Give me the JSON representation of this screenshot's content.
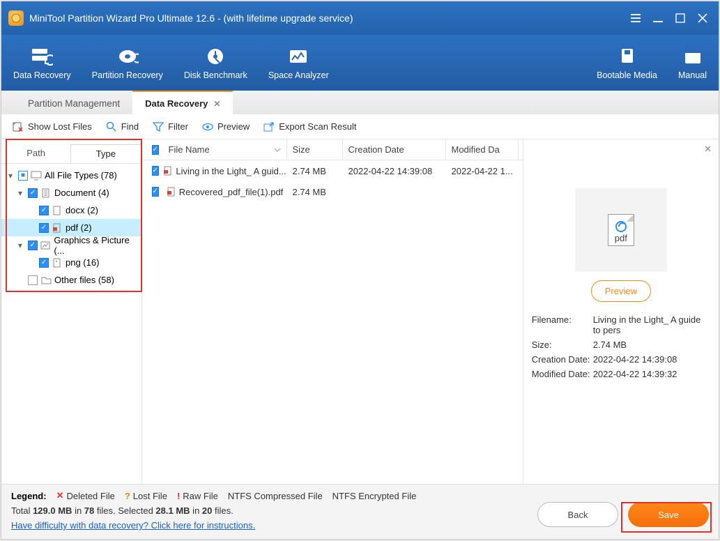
{
  "window": {
    "title": "MiniTool Partition Wizard Pro Ultimate 12.6 - (with lifetime upgrade service)"
  },
  "ribbon": {
    "data_recovery": "Data Recovery",
    "partition_recovery": "Partition Recovery",
    "disk_benchmark": "Disk Benchmark",
    "space_analyzer": "Space Analyzer",
    "bootable_media": "Bootable Media",
    "manual": "Manual"
  },
  "tabs": {
    "partition_mgmt": "Partition Management",
    "data_recovery": "Data Recovery"
  },
  "toolbar": {
    "show_lost": "Show Lost Files",
    "find": "Find",
    "filter": "Filter",
    "preview": "Preview",
    "export": "Export Scan Result"
  },
  "tree_tabs": {
    "path": "Path",
    "type": "Type"
  },
  "tree": {
    "all": "All File Types (78)",
    "doc": "Document (4)",
    "docx": "docx (2)",
    "pdf": "pdf (2)",
    "gfx": "Graphics & Picture (...",
    "png": "png (16)",
    "other": "Other files (58)"
  },
  "grid": {
    "headers": {
      "name": "File Name",
      "size": "Size",
      "cd": "Creation Date",
      "md": "Modified Da"
    },
    "rows": [
      {
        "name": "Living in the Light_ A guid...",
        "size": "2.74 MB",
        "cd": "2022-04-22 14:39:08",
        "md": "2022-04-22 1..."
      },
      {
        "name": "Recovered_pdf_file(1).pdf",
        "size": "2.74 MB",
        "cd": "",
        "md": ""
      }
    ]
  },
  "details": {
    "preview_btn": "Preview",
    "thumb_label": "pdf",
    "rows": {
      "filename_l": "Filename:",
      "filename_v": "Living in the Light_ A guide to pers",
      "size_l": "Size:",
      "size_v": "2.74 MB",
      "cd_l": "Creation Date:",
      "cd_v": "2022-04-22 14:39:08",
      "md_l": "Modified Date:",
      "md_v": "2022-04-22 14:39:32"
    }
  },
  "footer": {
    "legend_label": "Legend:",
    "deleted": "Deleted File",
    "lost": "Lost File",
    "raw": "Raw File",
    "ntfs_comp": "NTFS Compressed File",
    "ntfs_enc": "NTFS Encrypted File",
    "totals_a": "Total ",
    "totals_b": "129.0 MB",
    "totals_c": " in ",
    "totals_d": "78",
    "totals_e": " files.  Selected ",
    "totals_f": "28.1 MB",
    "totals_g": " in ",
    "totals_h": "20",
    "totals_i": " files.",
    "help_link": "Have difficulty with data recovery? Click here for instructions.",
    "back": "Back",
    "save": "Save"
  }
}
